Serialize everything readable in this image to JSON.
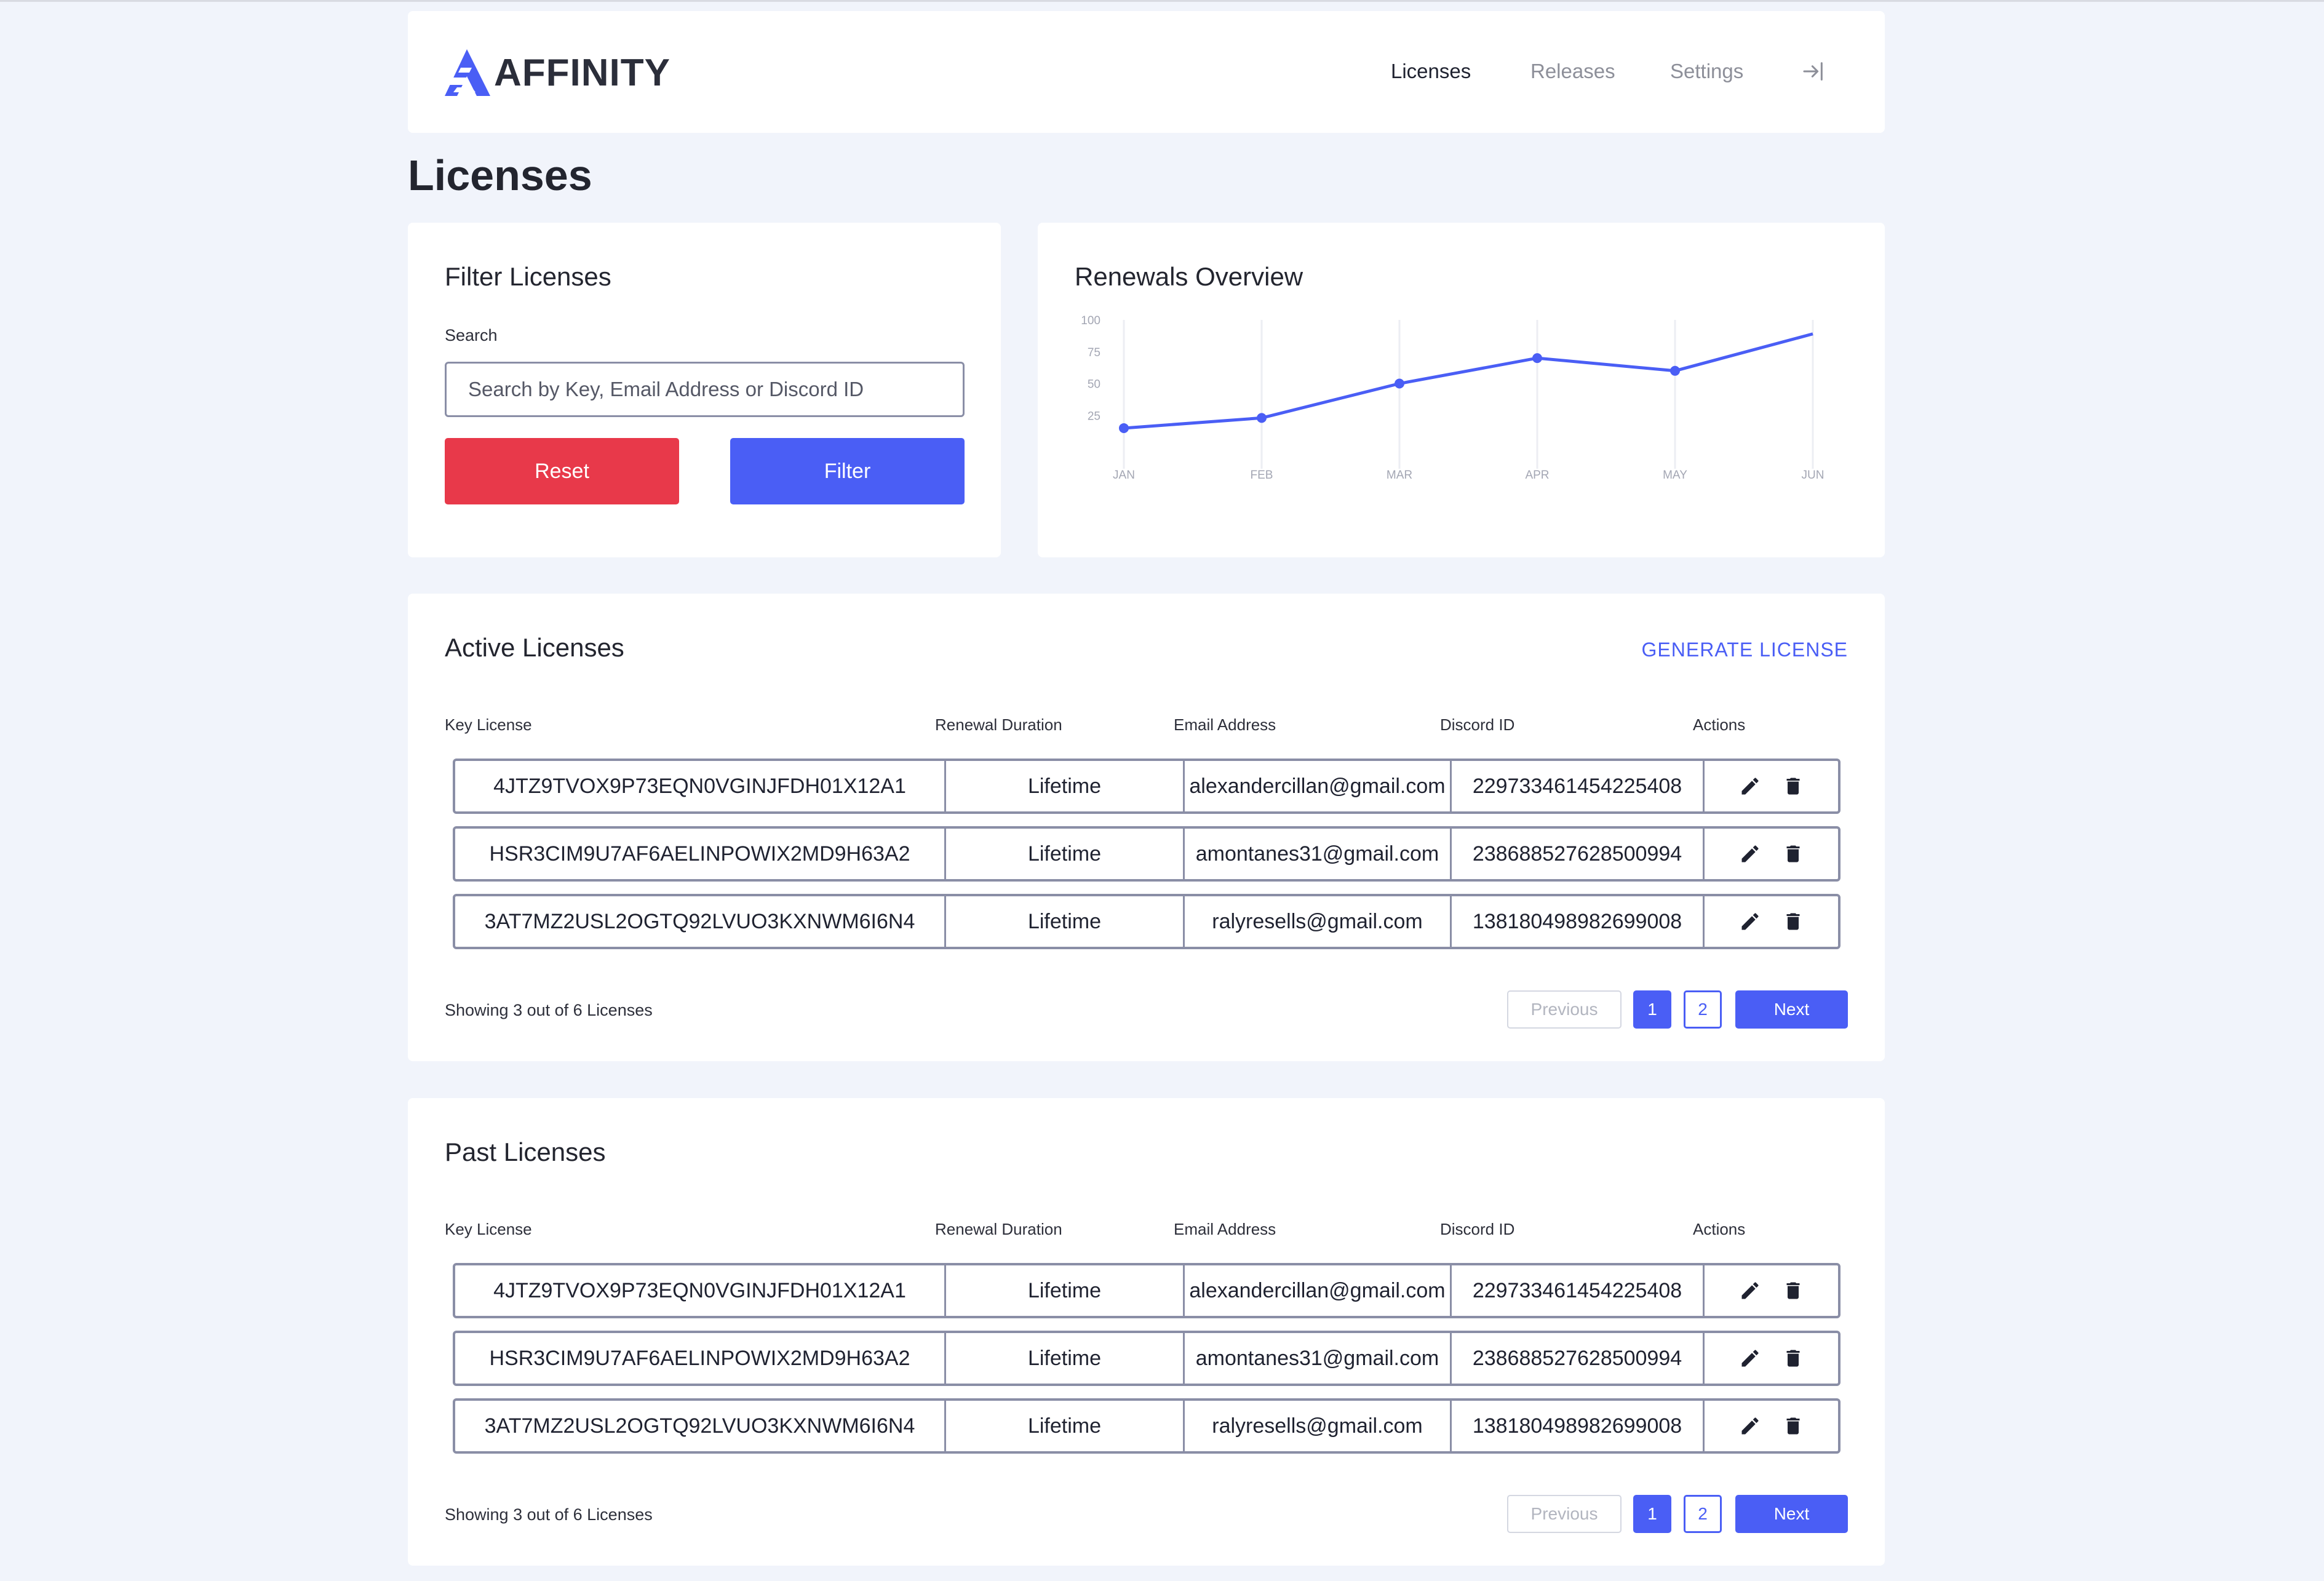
{
  "app": {
    "logo_text": "AFFINITY",
    "brand_color": "#4a5ef5"
  },
  "nav": {
    "items": [
      {
        "label": "Licenses",
        "active": true
      },
      {
        "label": "Releases",
        "active": false
      },
      {
        "label": "Settings",
        "active": false
      }
    ],
    "logout_icon": "logout-icon"
  },
  "page": {
    "title": "Licenses"
  },
  "filter": {
    "title": "Filter Licenses",
    "search_label": "Search",
    "search_placeholder": "Search by Key, Email Address or Discord ID",
    "search_value": "",
    "reset_label": "Reset",
    "filter_label": "Filter",
    "reset_color": "#e8394a"
  },
  "renewals": {
    "title": "Renewals Overview",
    "chart_data": {
      "type": "line",
      "title": "Renewals Overview",
      "x": [
        "JAN",
        "FEB",
        "MAR",
        "APR",
        "MAY",
        "JUN"
      ],
      "series": [
        {
          "values": [
            15,
            23,
            50,
            70,
            60,
            89
          ]
        }
      ],
      "yticks": [
        25,
        50,
        75,
        100
      ],
      "ylim": [
        0,
        100
      ],
      "grid": "vertical",
      "color": "#4a5ef5"
    }
  },
  "active": {
    "title": "Active Licenses",
    "generate_label": "GENERATE LICENSE",
    "columns": [
      "Key License",
      "Renewal Duration",
      "Email Address",
      "Discord ID",
      "Actions"
    ],
    "rows": [
      {
        "key": "4JTZ9TVOX9P73EQN0VGINJFDH01X12A1",
        "duration": "Lifetime",
        "email": "alexandercillan@gmail.com",
        "discord": "229733461454225408"
      },
      {
        "key": "HSR3CIM9U7AF6AELINPOWIX2MD9H63A2",
        "duration": "Lifetime",
        "email": "amontanes31@gmail.com",
        "discord": "238688527628500994"
      },
      {
        "key": "3AT7MZ2USL2OGTQ92LVUO3KXNWM6I6N4",
        "duration": "Lifetime",
        "email": "ralyresells@gmail.com",
        "discord": "138180498982699008"
      }
    ],
    "showing": "Showing 3 out of 6 Licenses",
    "pagination": {
      "previous": "Previous",
      "pages": [
        "1",
        "2"
      ],
      "next": "Next",
      "current": 1
    }
  },
  "past": {
    "title": "Past Licenses",
    "columns": [
      "Key License",
      "Renewal Duration",
      "Email Address",
      "Discord ID",
      "Actions"
    ],
    "rows": [
      {
        "key": "4JTZ9TVOX9P73EQN0VGINJFDH01X12A1",
        "duration": "Lifetime",
        "email": "alexandercillan@gmail.com",
        "discord": "229733461454225408"
      },
      {
        "key": "HSR3CIM9U7AF6AELINPOWIX2MD9H63A2",
        "duration": "Lifetime",
        "email": "amontanes31@gmail.com",
        "discord": "238688527628500994"
      },
      {
        "key": "3AT7MZ2USL2OGTQ92LVUO3KXNWM6I6N4",
        "duration": "Lifetime",
        "email": "ralyresells@gmail.com",
        "discord": "138180498982699008"
      }
    ],
    "showing": "Showing 3 out of 6 Licenses",
    "pagination": {
      "previous": "Previous",
      "pages": [
        "1",
        "2"
      ],
      "next": "Next",
      "current": 1
    }
  },
  "icons": {
    "edit": "pencil-icon",
    "delete": "trash-icon"
  }
}
